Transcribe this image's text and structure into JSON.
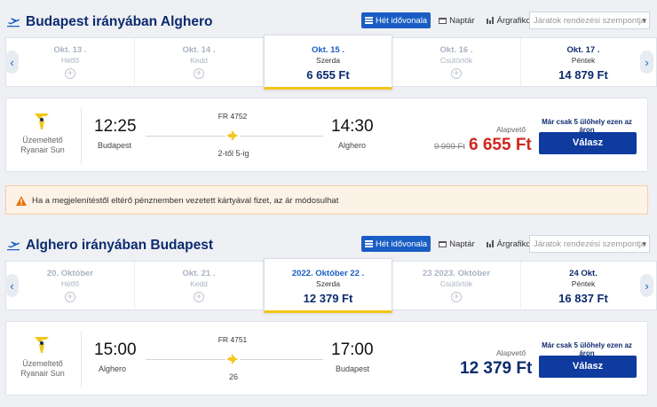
{
  "outbound": {
    "title": "Budapest irányában Alghero",
    "views": {
      "timeline": "Hét idővonala",
      "calendar": "Naptár",
      "chart": "Árgrafikon"
    },
    "sort_placeholder": "Járatok rendezési szempontja",
    "dates": [
      {
        "date": "Okt. 13 .",
        "weekday": "Hétfő",
        "price": ""
      },
      {
        "date": "Okt. 14 .",
        "weekday": "Kedd",
        "price": ""
      },
      {
        "date": "Okt. 15 .",
        "weekday": "Szerda",
        "price": "6 655 Ft"
      },
      {
        "date": "Okt. 16 .",
        "weekday": "Csütörtök",
        "price": ""
      },
      {
        "date": "Okt. 17 .",
        "weekday": "Péntek",
        "price": "14 879 Ft"
      }
    ],
    "flight": {
      "operator_line1": "Üzemeltető",
      "operator_line2": "Ryanair Sun",
      "dep_time": "12:25",
      "dep_city": "Budapest",
      "arr_time": "14:30",
      "arr_city": "Alghero",
      "flight_no": "FR 4752",
      "terminal": "2-től 5-ig",
      "fare_label": "Alapvető",
      "old_price": "9 999 Ft",
      "price": "6 655 Ft",
      "price_color": "#d0261d",
      "seats_left": "Már csak 5 ülőhely ezen az áron",
      "select_label": "Válasz"
    }
  },
  "notice": {
    "text": "Ha a megjelenítéstől eltérő pénznemben vezetett kártyával fizet, az ár módosulhat"
  },
  "inbound": {
    "title": "Alghero irányában Budapest",
    "views": {
      "timeline": "Hét idővonala",
      "calendar": "Naptár",
      "chart": "Árgrafikon"
    },
    "sort_placeholder": "Járatok rendezési szempontja",
    "dates": [
      {
        "date": "20. Október",
        "weekday": "Hétfő",
        "price": ""
      },
      {
        "date": "Okt. 21 .",
        "weekday": "Kedd",
        "price": ""
      },
      {
        "date": "2022. Október 22 .",
        "weekday": "Szerda",
        "price": "12 379 Ft"
      },
      {
        "date": "23 2023. Október",
        "weekday": "Csütörtök",
        "price": ""
      },
      {
        "date": "24 Okt.",
        "weekday": "Péntek",
        "price": "16 837 Ft"
      }
    ],
    "flight": {
      "operator_line1": "Üzemeltető",
      "operator_line2": "Ryanair Sun",
      "dep_time": "15:00",
      "dep_city": "Alghero",
      "arr_time": "17:00",
      "arr_city": "Budapest",
      "flight_no": "FR 4751",
      "terminal": "26",
      "fare_label": "Alapvető",
      "old_price": "",
      "price": "12 379 Ft",
      "price_color": "#0c2b6e",
      "seats_left": "Már csak 5 ülőhely ezen az áron",
      "select_label": "Válasz"
    }
  },
  "colors": {
    "brand": "#0f3a9e",
    "accent": "#1a5dc4",
    "highlight": "#f2c518",
    "sale": "#d0261d"
  }
}
